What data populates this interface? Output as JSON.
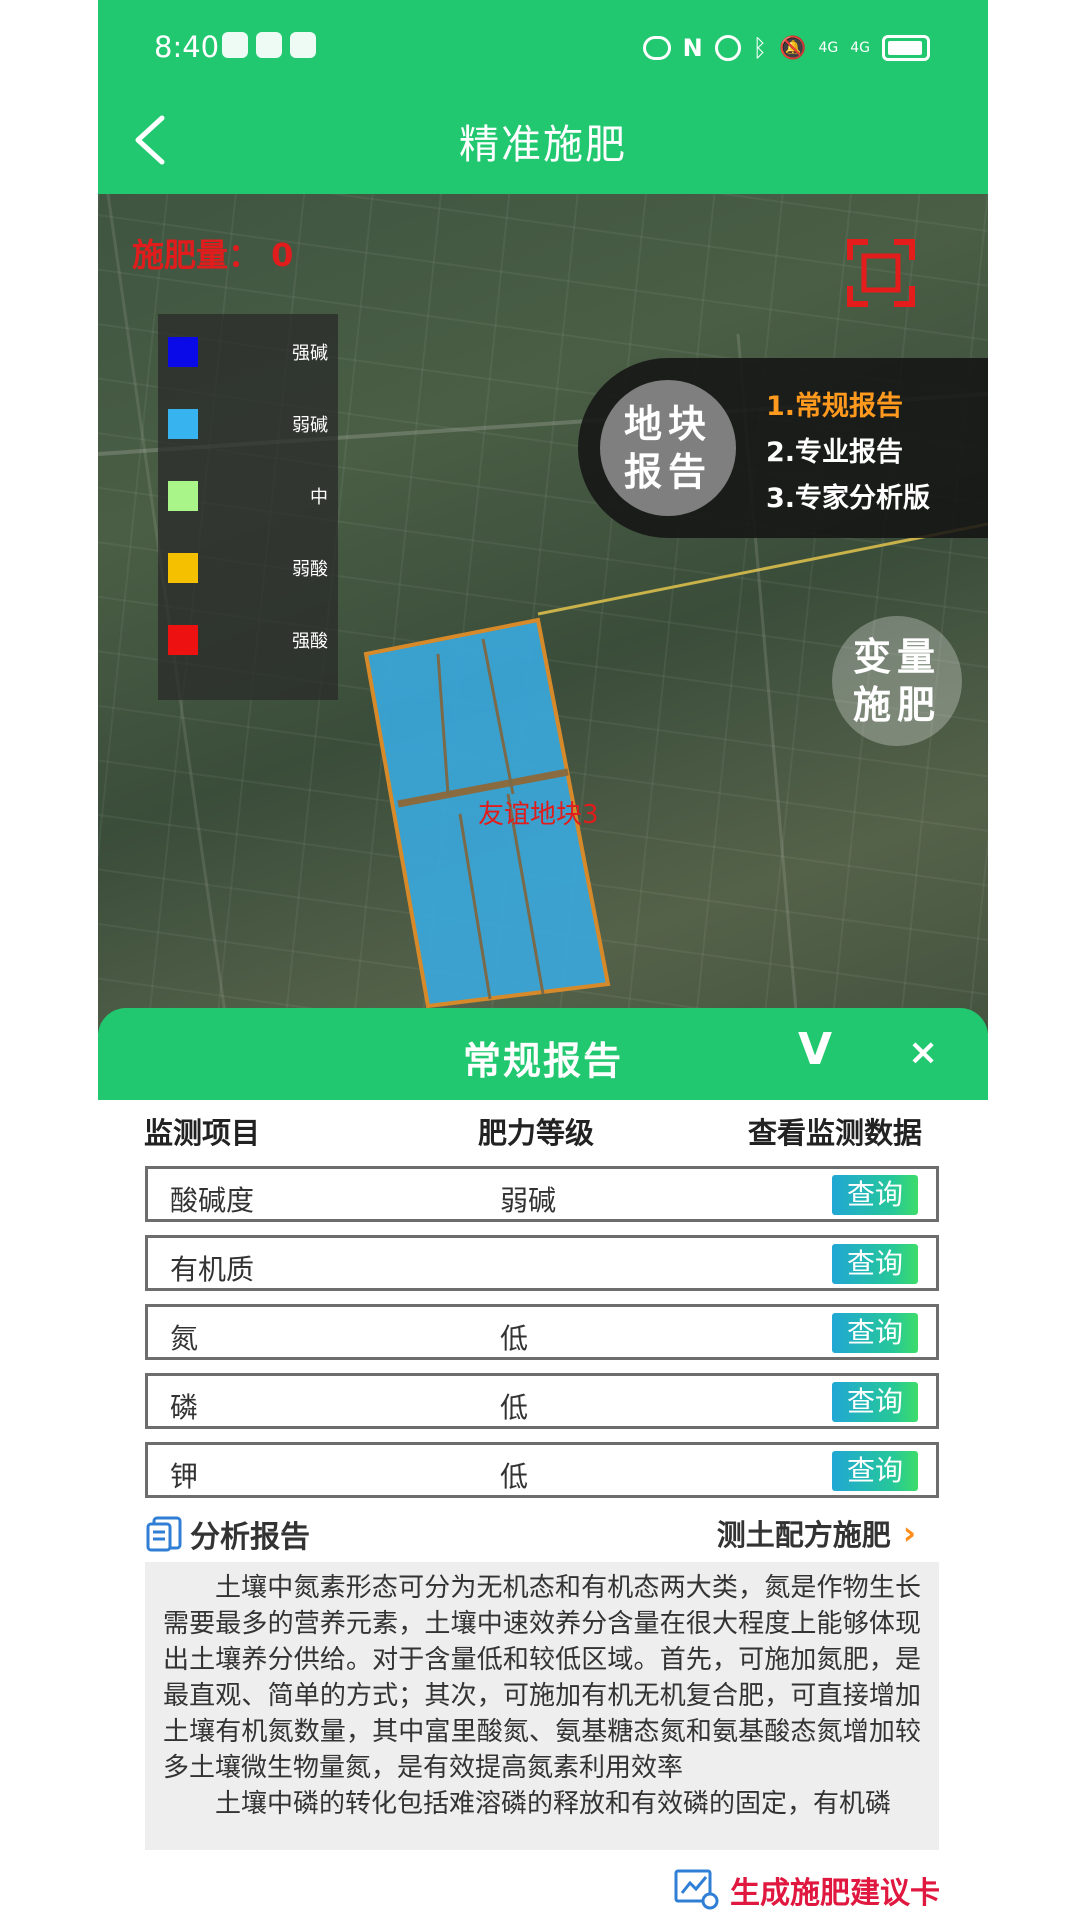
{
  "status_bar": {
    "time": "8:40",
    "network": "4G"
  },
  "header": {
    "title": "精准施肥"
  },
  "map": {
    "fertilizer_label": "施肥量：",
    "fertilizer_amount": "0",
    "legend": [
      {
        "label": "强碱",
        "color": "#0a0ae8"
      },
      {
        "label": "弱碱",
        "color": "#37b4f0"
      },
      {
        "label": "中",
        "color": "#a9f58a"
      },
      {
        "label": "弱酸",
        "color": "#f5c000"
      },
      {
        "label": "强酸",
        "color": "#ee1111"
      }
    ],
    "plot_report": {
      "circle_line1": "地块",
      "circle_line2": "报告",
      "options": [
        "1.常规报告",
        "2.专业报告",
        "3.专家分析版"
      ]
    },
    "variable_fert": {
      "line1": "变量",
      "line2": "施肥"
    },
    "field_name": "友谊地块3"
  },
  "report": {
    "title": "常规报告",
    "collapse": "V",
    "close": "×",
    "columns": [
      "监测项目",
      "肥力等级",
      "查看监测数据"
    ],
    "rows": [
      {
        "item": "酸碱度",
        "level": "弱碱",
        "action": "查询"
      },
      {
        "item": "有机质",
        "level": "",
        "action": "查询"
      },
      {
        "item": "氮",
        "level": "低",
        "action": "查询"
      },
      {
        "item": "磷",
        "level": "低",
        "action": "查询"
      },
      {
        "item": "钾",
        "level": "低",
        "action": "查询"
      }
    ],
    "analysis_title": "分析报告",
    "soil_link": "测土配方施肥",
    "paragraphs": [
      "土壤中氮素形态可分为无机态和有机态两大类，氮是作物生长需要最多的营养元素，土壤中速效养分含量在很大程度上能够体现出土壤养分供给。对于含量低和较低区域。首先，可施加氮肥，是最直观、简单的方式；其次，可施加有机无机复合肥，可直接增加土壤有机氮数量，其中富里酸氮、氨基糖态氮和氨基酸态氮增加较多土壤微生物量氮，是有效提高氮素利用效率",
      "土壤中磷的转化包括难溶磷的释放和有效磷的固定，有机磷"
    ],
    "generate_card": "生成施肥建议卡"
  }
}
